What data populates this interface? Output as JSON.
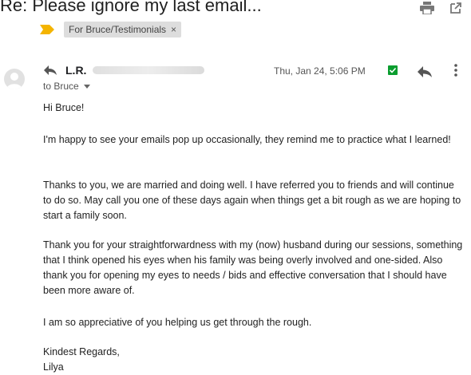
{
  "email": {
    "subject": "Re: Please ignore my last email...",
    "label_chip": "For Bruce/Testimonials",
    "label_remove": "×",
    "sender_name": "L.R.",
    "to_text": "to Bruce",
    "date": "Thu, Jan 24, 5:06 PM",
    "greeting": "Hi Bruce!",
    "paragraph1": "I'm happy to see your emails pop up occasionally, they remind me to practice what I learned!",
    "paragraph2": "Thanks to you, we are married and doing well. I have referred you to friends and will continue to do so. May call you one of these days again when things get a bit rough as we are hoping to start a family soon.",
    "paragraph3": "Thank you for your straightforwardness with my (now) husband during our sessions, something that I think opened his eyes when his family was being overly involved and one-sided. Also thank you for opening my eyes to needs / bids and effective conversation that I should have been more aware of.",
    "paragraph4": "I am so appreciative of you helping us get through the rough.",
    "closing": "Kindest Regards,",
    "signature": "Lilya"
  },
  "icons": {
    "print": "print-icon",
    "open_new_window": "open-in-new-window-icon",
    "label_arrow": "label-arrow-icon",
    "avatar": "avatar-icon",
    "reply_small": "reply-icon",
    "checkbox": "checkbox-checked-icon",
    "reply": "reply-icon",
    "more": "more-vert-icon"
  },
  "colors": {
    "label_arrow": "#f4b400",
    "checkbox": "#0a9d2f",
    "chip_bg": "#dddddd"
  }
}
